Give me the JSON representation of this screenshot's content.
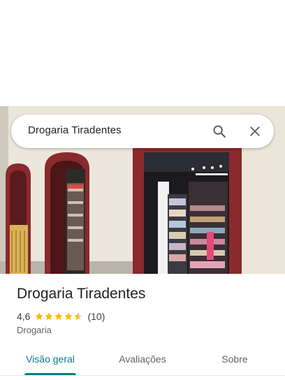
{
  "search": {
    "query": "Drogaria Tiradentes",
    "search_icon": "search-icon",
    "close_icon": "close-icon"
  },
  "photo": {
    "description_icon": "storefront-photo"
  },
  "place": {
    "name": "Drogaria Tiradentes",
    "rating": "4,6",
    "rating_value": 4.6,
    "rating_max": 5,
    "reviews": "(10)",
    "category": "Drogaria"
  },
  "tabs": [
    {
      "label": "Visão geral",
      "active": true
    },
    {
      "label": "Avaliações",
      "active": false
    },
    {
      "label": "Sobre",
      "active": false
    }
  ],
  "colors": {
    "accent": "#0a7c8c",
    "star": "#fbbc04",
    "star_empty": "#dadce0",
    "door_red": "#7a1f24"
  }
}
